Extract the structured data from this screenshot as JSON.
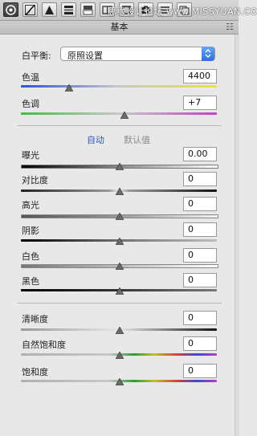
{
  "toolbar": {
    "watermark": "思缘设计论坛 www.MISSYUAN.COM",
    "icons": [
      "aperture-icon",
      "tone-curve-icon",
      "detail-triangle-icon",
      "hsl-icon",
      "split-toning-icon",
      "lens-icon",
      "effects-icon",
      "camera-calibration-icon",
      "presets-icon",
      "snapshots-icon"
    ]
  },
  "panel": {
    "title": "基本"
  },
  "white_balance": {
    "label": "白平衡:",
    "selected": "原照设置"
  },
  "sliders_top": [
    {
      "label": "色温",
      "value": "4400"
    },
    {
      "label": "色调",
      "value": "+7"
    }
  ],
  "tone_links": {
    "auto": "自动",
    "default": "默认值"
  },
  "sliders_tone": [
    {
      "label": "曝光",
      "value": "0.00"
    },
    {
      "label": "对比度",
      "value": "0"
    },
    {
      "label": "高光",
      "value": "0"
    },
    {
      "label": "阴影",
      "value": "0"
    },
    {
      "label": "白色",
      "value": "0"
    },
    {
      "label": "黑色",
      "value": "0"
    }
  ],
  "sliders_presence": [
    {
      "label": "清晰度",
      "value": "0"
    },
    {
      "label": "自然饱和度",
      "value": "0"
    },
    {
      "label": "饱和度",
      "value": "0"
    }
  ],
  "colors": {
    "temp_track": "#3b5bd6 to #e6e23a",
    "tint_track": "#3fb83f to #c83fc8"
  }
}
